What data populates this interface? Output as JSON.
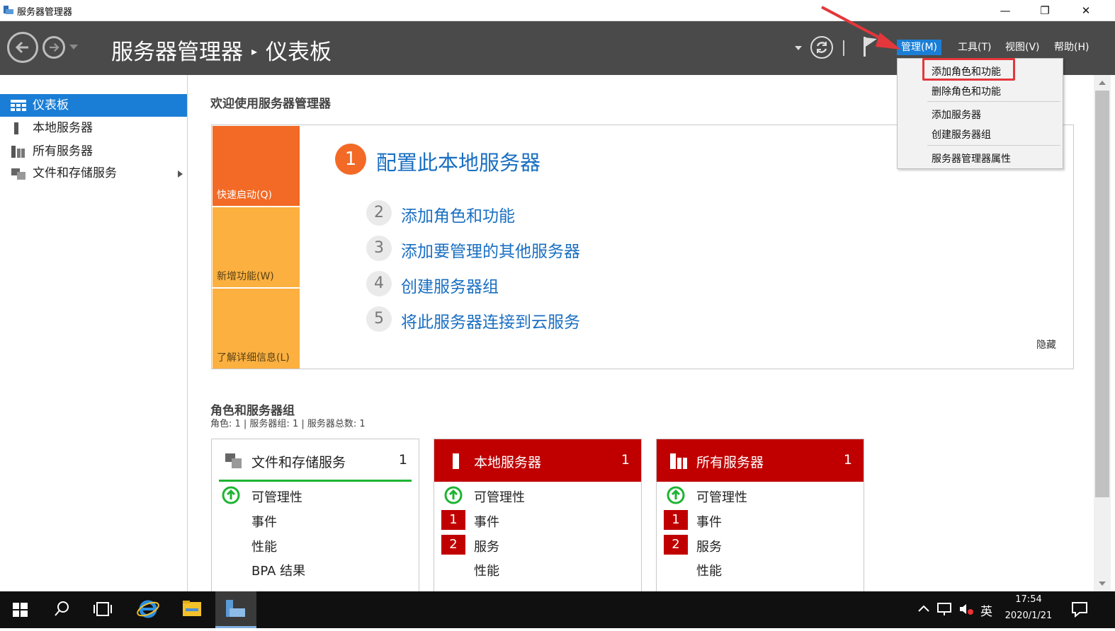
{
  "window": {
    "title": "服务器管理器",
    "min": "—",
    "max": "❐",
    "close": "✕"
  },
  "header": {
    "app_name": "服务器管理器",
    "separator": "▸",
    "page": "仪表板",
    "menus": [
      "管理(M)",
      "工具(T)",
      "视图(V)",
      "帮助(H)"
    ],
    "active_menu": "管理(M)"
  },
  "manage_menu": {
    "items": [
      "添加角色和功能",
      "删除角色和功能",
      "添加服务器",
      "创建服务器组",
      "服务器管理器属性"
    ],
    "highlighted": "添加角色和功能"
  },
  "sidebar": {
    "items": [
      {
        "label": "仪表板",
        "selected": true
      },
      {
        "label": "本地服务器",
        "selected": false
      },
      {
        "label": "所有服务器",
        "selected": false
      },
      {
        "label": "文件和存储服务",
        "selected": false
      }
    ]
  },
  "welcome": {
    "title": "欢迎使用服务器管理器",
    "tiles": [
      "快速启动(Q)",
      "新增功能(W)",
      "了解详细信息(L)"
    ],
    "steps": [
      {
        "num": "1",
        "text": "配置此本地服务器"
      },
      {
        "num": "2",
        "text": "添加角色和功能"
      },
      {
        "num": "3",
        "text": "添加要管理的其他服务器"
      },
      {
        "num": "4",
        "text": "创建服务器组"
      },
      {
        "num": "5",
        "text": "将此服务器连接到云服务"
      }
    ],
    "hide": "隐藏"
  },
  "roles": {
    "title": "角色和服务器组",
    "summary": "角色: 1 | 服务器组: 1 | 服务器总数: 1",
    "cards": [
      {
        "title": "文件和存储服务",
        "count": "1",
        "alert": false,
        "rows": [
          "可管理性",
          "事件",
          "性能",
          "BPA 结果"
        ]
      },
      {
        "title": "本地服务器",
        "count": "1",
        "alert": true,
        "rows": [
          "可管理性",
          "事件",
          "服务",
          "性能"
        ],
        "badges": {
          "events": "1",
          "services": "2"
        }
      },
      {
        "title": "所有服务器",
        "count": "1",
        "alert": true,
        "rows": [
          "可管理性",
          "事件",
          "服务",
          "性能"
        ],
        "badges": {
          "events": "1",
          "services": "2"
        }
      }
    ]
  },
  "taskbar": {
    "ime": "英",
    "time": "17:54",
    "date": "2020/1/21"
  },
  "colors": {
    "header_bg": "#4a4a4a",
    "accent_blue": "#1a7ed6",
    "orange": "#f26a25",
    "light_orange": "#fbb040",
    "alert_red": "#c00000",
    "ok_green": "#1eb432",
    "callout_red": "#e3373b"
  }
}
